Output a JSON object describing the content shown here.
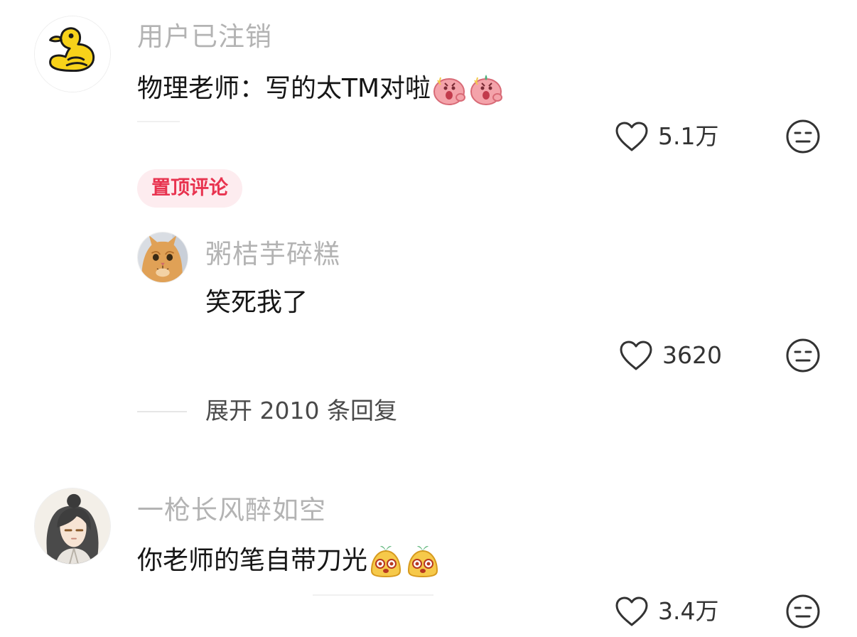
{
  "comments": [
    {
      "username": "用户已注销",
      "text": "物理老师：写的太TM对啦",
      "emojis": [
        "angry-blob-emoji",
        "angry-blob-emoji"
      ],
      "like_count": "5.1万",
      "pinned_label": "置顶评论"
    },
    {
      "username": "一枪长风醉如空",
      "text": "你老师的笔自带刀光",
      "emojis": [
        "dumpling-face-emoji",
        "dumpling-face-emoji"
      ],
      "like_count": "3.4万"
    }
  ],
  "reply": {
    "username": "粥桔芋碎糕",
    "text": "笑死我了",
    "like_count": "3620"
  },
  "expand_replies_label": "展开 2010 条回复",
  "icons": {
    "like": "heart-outline-icon",
    "dislike": "meh-face-icon"
  },
  "colors": {
    "username": "#b3b3b3",
    "text": "#161616",
    "pinned_text": "#e8334f",
    "pinned_bg": "#fdecef"
  }
}
